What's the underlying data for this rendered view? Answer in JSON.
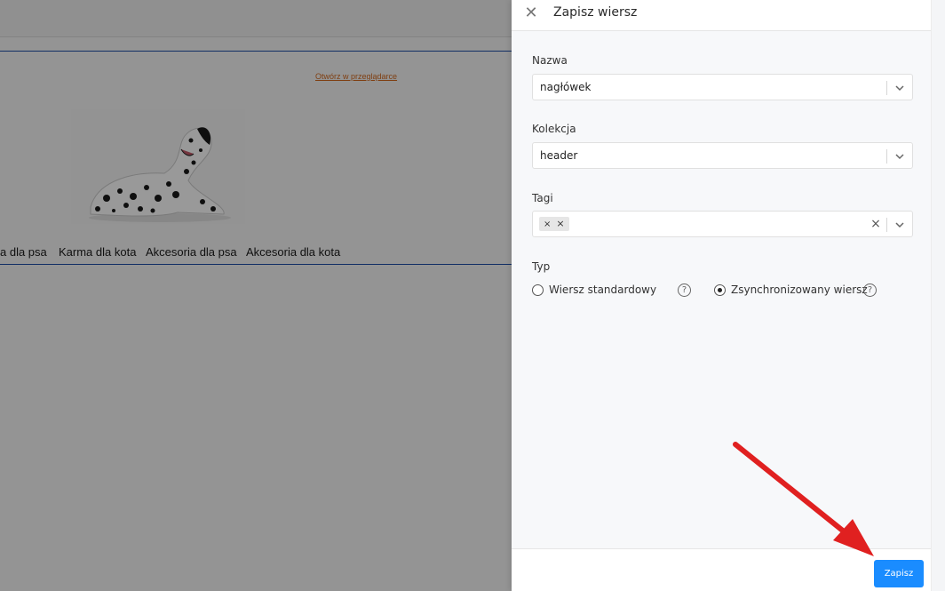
{
  "background": {
    "email_link": "Otwórz w przeglądarce",
    "menu_items": [
      "a dla psa",
      "Karma dla kota",
      "Akcesoria dla psa",
      "Akcesoria dla kota"
    ]
  },
  "panel": {
    "close_icon": "close-icon",
    "title": "Zapisz wiersz",
    "name_field": {
      "label": "Nazwa",
      "value": "nagłówek"
    },
    "collection_field": {
      "label": "Kolekcja",
      "value": "header"
    },
    "tags_field": {
      "label": "Tagi",
      "chip_text": "×",
      "clear_symbol": "×"
    },
    "type": {
      "label": "Typ",
      "options": [
        {
          "label": "Wiersz standardowy",
          "selected": false
        },
        {
          "label": "Zsynchronizowany wiersz",
          "selected": true
        }
      ],
      "help_symbol": "?"
    },
    "save_label": "Zapisz"
  },
  "colors": {
    "accent": "#1a8cff",
    "annotation_arrow": "#e02020",
    "link": "#d46a1f",
    "divider_line": "#1f4fa8"
  }
}
